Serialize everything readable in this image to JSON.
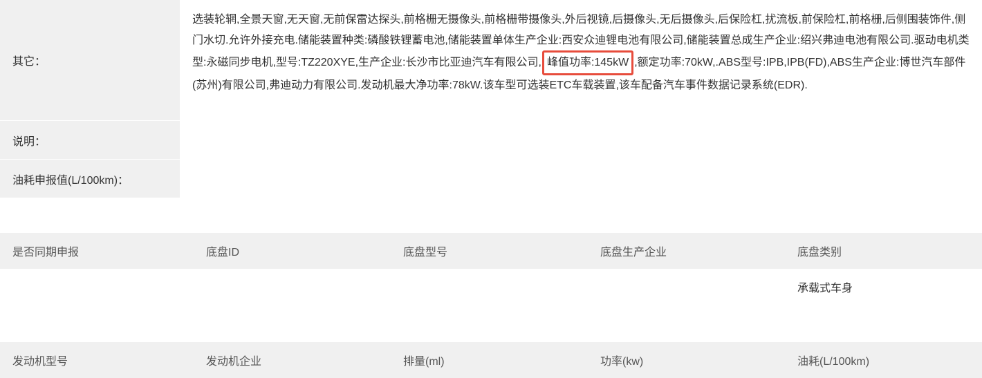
{
  "rows": {
    "other": {
      "label": "其它：",
      "value_pre": "选装轮辋,全景天窗,无天窗,无前保雷达探头,前格栅无摄像头,前格栅带摄像头,外后视镜,后摄像头,无后摄像头,后保险杠,扰流板,前保险杠,前格栅,后侧围装饰件,侧门水切.允许外接充电.储能装置种类:磷酸铁锂蓄电池,储能装置单体生产企业:西安众迪锂电池有限公司,储能装置总成生产企业:绍兴弗迪电池有限公司.驱动电机类型:永磁同步电机,型号:TZ220XYE,生产企业:长沙市比亚迪汽车有限公司,",
      "value_highlight": "峰值功率:145kW",
      "value_post": ",额定功率:70kW,.ABS型号:IPB,IPB(FD),ABS生产企业:博世汽车部件(苏州)有限公司,弗迪动力有限公司.发动机最大净功率:78kW.该车型可选装ETC车载装置,该车配备汽车事件数据记录系统(EDR)."
    },
    "desc": {
      "label": "说明：",
      "value": ""
    },
    "fuel": {
      "label": "油耗申报值(L/100km)：",
      "value": ""
    }
  },
  "chassis_header": {
    "col1": "是否同期申报",
    "col2": "底盘ID",
    "col3": "底盘型号",
    "col4": "底盘生产企业",
    "col5": "底盘类别"
  },
  "chassis_row": {
    "col1": "",
    "col2": "",
    "col3": "",
    "col4": "",
    "col5": "承载式车身"
  },
  "engine_header": {
    "col1": "发动机型号",
    "col2": "发动机企业",
    "col3": "排量(ml)",
    "col4": "功率(kw)",
    "col5": "油耗(L/100km)"
  }
}
